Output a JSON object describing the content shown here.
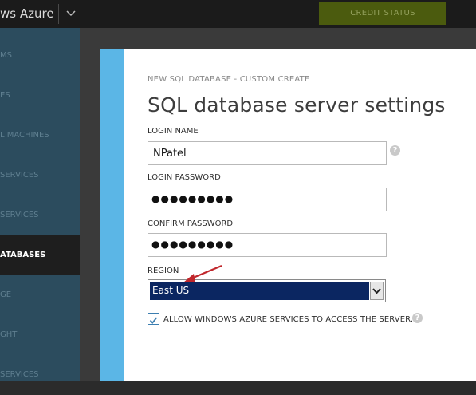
{
  "topbar": {
    "brand": "ws Azure",
    "credit_status": "CREDIT STATUS"
  },
  "sidebar": {
    "items": [
      {
        "label": "MS"
      },
      {
        "label": "ES"
      },
      {
        "label": "L MACHINES"
      },
      {
        "label": "SERVICES"
      },
      {
        "label": "SERVICES"
      },
      {
        "label": "ATABASES",
        "active": true
      },
      {
        "label": "GE"
      },
      {
        "label": "GHT"
      },
      {
        "label": "SERVICES"
      }
    ]
  },
  "dialog": {
    "subtitle": "NEW SQL DATABASE - CUSTOM CREATE",
    "title": "SQL database server settings",
    "login_name": {
      "label": "LOGIN NAME",
      "value": "NPatel"
    },
    "login_password": {
      "label": "LOGIN PASSWORD",
      "masked": "●●●●●●●●●"
    },
    "confirm_password": {
      "label": "CONFIRM PASSWORD",
      "masked": "●●●●●●●●●"
    },
    "region": {
      "label": "REGION",
      "selected": "East US"
    },
    "allow_azure_services": {
      "label": "ALLOW WINDOWS AZURE SERVICES TO ACCESS THE SERVER.",
      "checked": true
    },
    "help_glyph": "?"
  },
  "colors": {
    "accent": "#5bb6e6",
    "selected_region_bg": "#0b2661",
    "annotation_arrow": "#c0262b",
    "credit_status_bg": "#4b5b0e"
  }
}
